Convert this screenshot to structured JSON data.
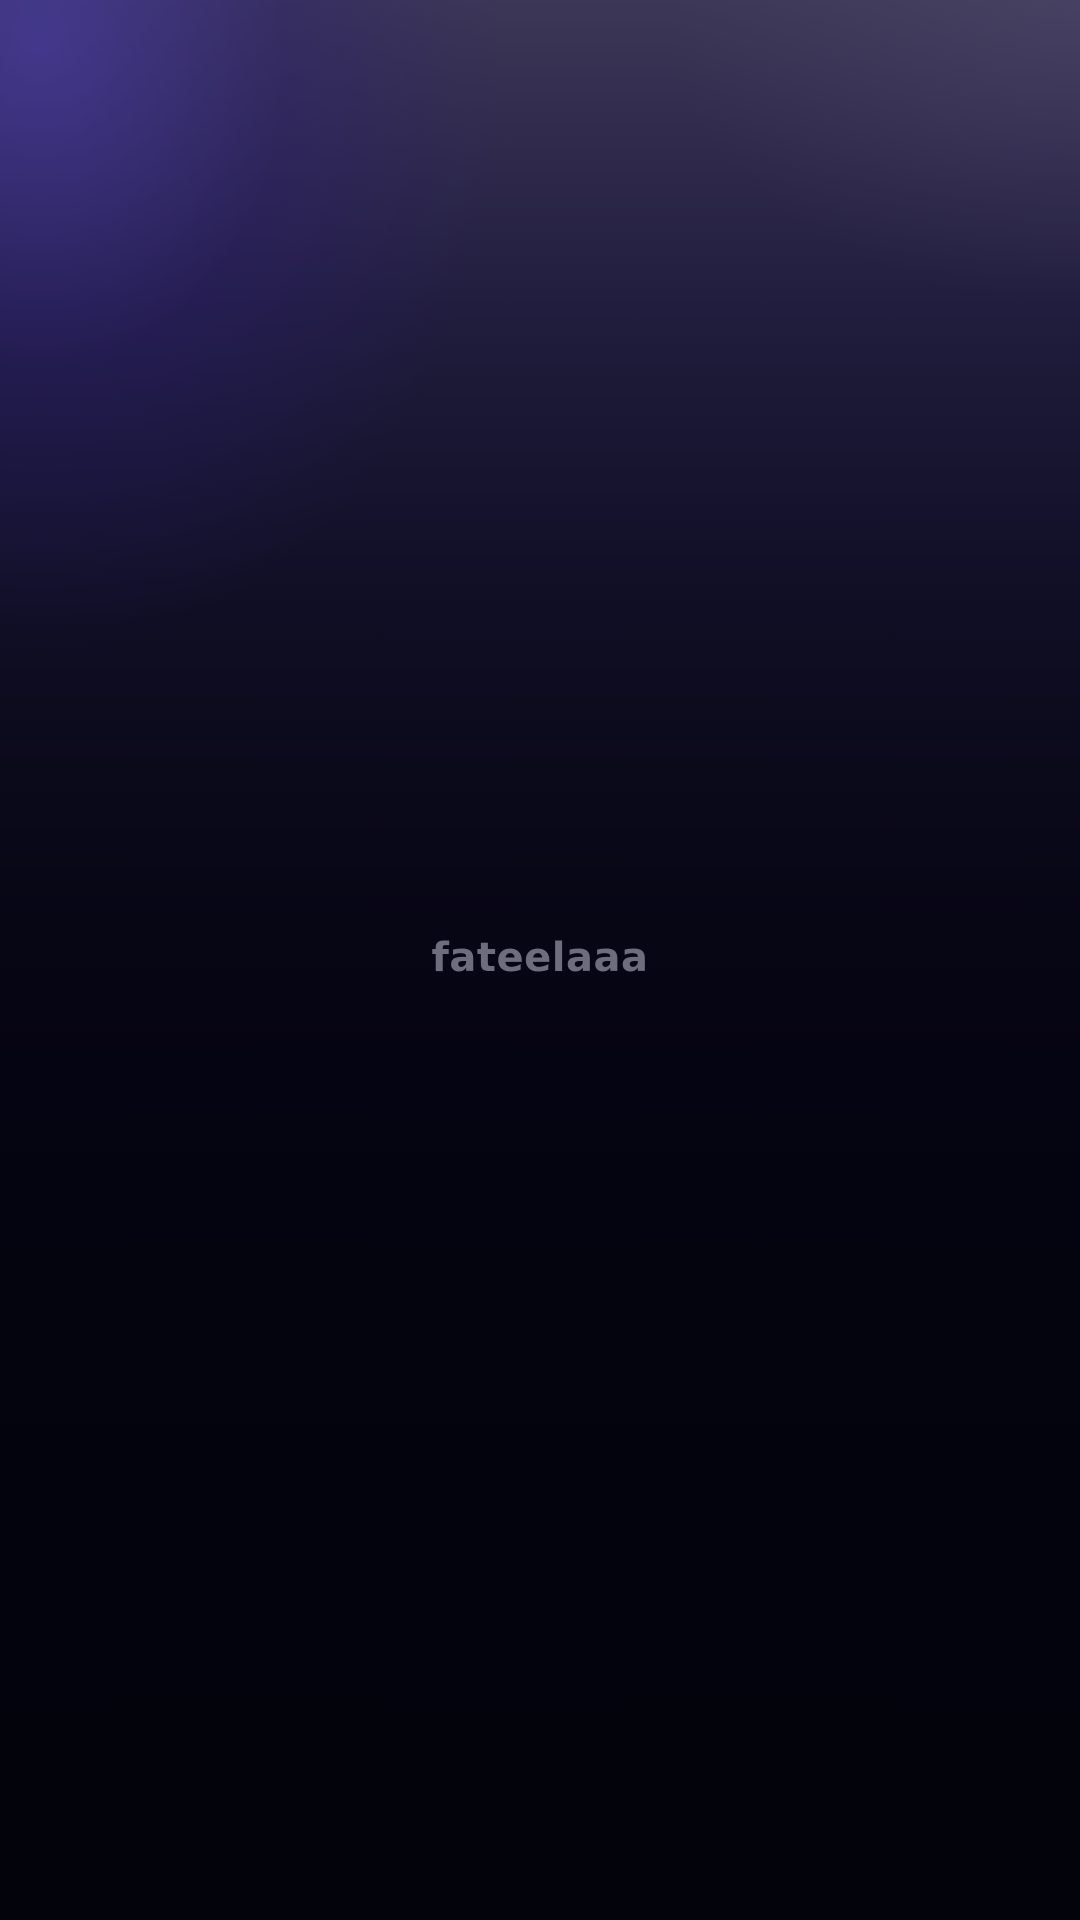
{
  "splash": {
    "brand_name": "fateelaaa"
  },
  "colors": {
    "brand_text": "#6e6d7d",
    "background_top": "#3c3756",
    "background_accent": "#483aaa",
    "background_bottom": "#03030c"
  }
}
